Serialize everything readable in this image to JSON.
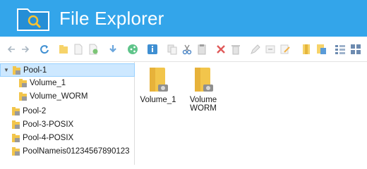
{
  "app": {
    "title": "File Explorer",
    "icon": "folder-search-icon"
  },
  "colors": {
    "titlebar": "#33a5ea",
    "selection": "#cde8ff",
    "folder": "#f2c54b"
  },
  "toolbar": {
    "buttons": [
      "back-icon",
      "forward-icon",
      "refresh-icon",
      "new-folder-icon",
      "new-file-icon",
      "add-file-icon",
      "download-icon",
      "share-icon",
      "info-icon",
      "copy-icon",
      "cut-icon",
      "paste-icon",
      "delete-icon",
      "trash-icon",
      "rename-icon",
      "move-icon",
      "edit-icon",
      "bookmark-icon",
      "properties-icon",
      "list-view-icon",
      "grid-view-icon"
    ]
  },
  "tree": {
    "items": [
      {
        "label": "Pool-1",
        "level": 0,
        "expanded": true,
        "selected": true
      },
      {
        "label": "Volume_1",
        "level": 1
      },
      {
        "label": "Volume_WORM",
        "level": 1
      },
      {
        "label": "Pool-2",
        "level": 0
      },
      {
        "label": "Pool-3-POSIX",
        "level": 0
      },
      {
        "label": "Pool-4-POSIX",
        "level": 0
      },
      {
        "label": "PoolNameis01234567890123",
        "level": 0
      }
    ]
  },
  "content": {
    "items": [
      {
        "name": "Volume_1"
      },
      {
        "name": "Volume\nWORM"
      }
    ]
  }
}
